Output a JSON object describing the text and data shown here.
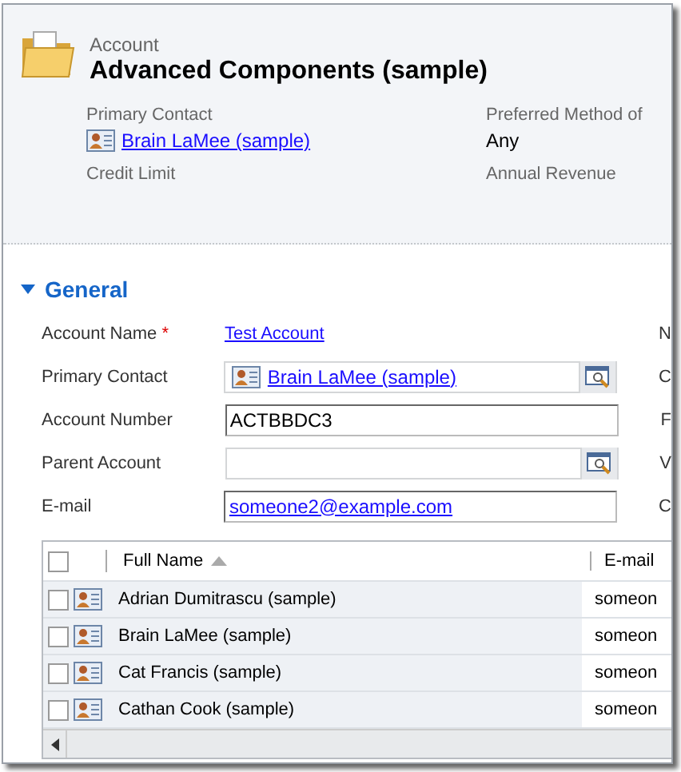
{
  "header": {
    "entity": "Account",
    "title": "Advanced Components (sample)",
    "fields": [
      {
        "label": "Primary Contact",
        "value": "Brain LaMee (sample)",
        "kind": "lookup"
      },
      {
        "label": "Preferred Method of",
        "value": "Any",
        "kind": "text"
      },
      {
        "label": "Credit Limit"
      },
      {
        "label": "Annual Revenue"
      }
    ]
  },
  "section": {
    "title": "General",
    "expanded": true,
    "fields": [
      {
        "label": "Account Name",
        "required_mark": "*",
        "kind": "link",
        "value": "Test Account",
        "column_2_label": "N"
      },
      {
        "label": "Primary Contact",
        "kind": "lookup",
        "value": "Brain LaMee (sample)",
        "column_2_label": "C"
      },
      {
        "label": "Account Number",
        "kind": "text",
        "value": "ACTBBDC3",
        "column_2_label": "F"
      },
      {
        "label": "Parent Account",
        "kind": "lookup",
        "column_2_label": "V"
      },
      {
        "label": "E-mail",
        "kind": "email",
        "value": "someone2@example.com",
        "column_2_label": "C"
      }
    ]
  },
  "grid": {
    "all_checked": false,
    "columns": [
      {
        "label": "Full Name",
        "sorted": true
      },
      {
        "label": "E-mail",
        "sorted": false
      }
    ],
    "rows": [
      {
        "checked": false,
        "full_name": "Adrian Dumitrascu (sample)",
        "email": "someon"
      },
      {
        "checked": false,
        "full_name": "Brain LaMee (sample)",
        "email": "someon"
      },
      {
        "checked": false,
        "full_name": "Cat Francis (sample)",
        "email": "someon"
      },
      {
        "checked": false,
        "full_name": "Cathan Cook (sample)",
        "email": "someon"
      }
    ]
  }
}
